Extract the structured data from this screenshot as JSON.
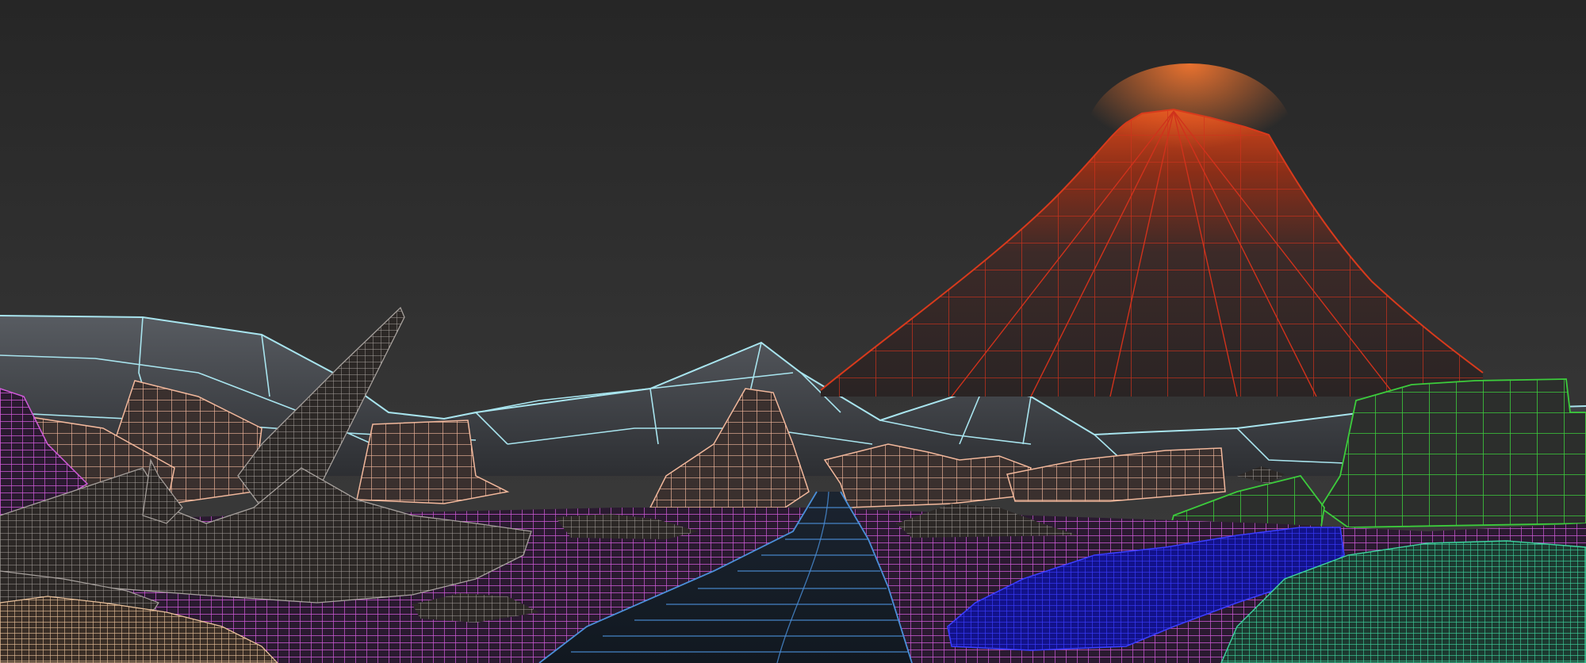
{
  "scene": {
    "type": "3d-viewport-wireframe-render",
    "objects": [
      {
        "name": "volcano",
        "wire_color": "#c8321e"
      },
      {
        "name": "distant-mountains",
        "wire_color": "#a8e4ee"
      },
      {
        "name": "rock-formations",
        "wire_color": "#f0b79a"
      },
      {
        "name": "jagged-rocks",
        "wire_color": "#9c9c9c"
      },
      {
        "name": "ground-plane",
        "wire_color": "#d65fe0"
      },
      {
        "name": "river",
        "wire_color": "#4a8fd8"
      },
      {
        "name": "blue-boulder",
        "wire_color": "#2a2cf0"
      },
      {
        "name": "green-rocks",
        "wire_color": "#40c840"
      },
      {
        "name": "teal-mound",
        "wire_color": "#3ad6a0"
      },
      {
        "name": "sand-mound",
        "wire_color": "#e8c09a"
      }
    ],
    "colors": {
      "background_top": "#262626",
      "background_bottom": "#3c3c3c",
      "lava_glow": "#e05a1e"
    }
  }
}
